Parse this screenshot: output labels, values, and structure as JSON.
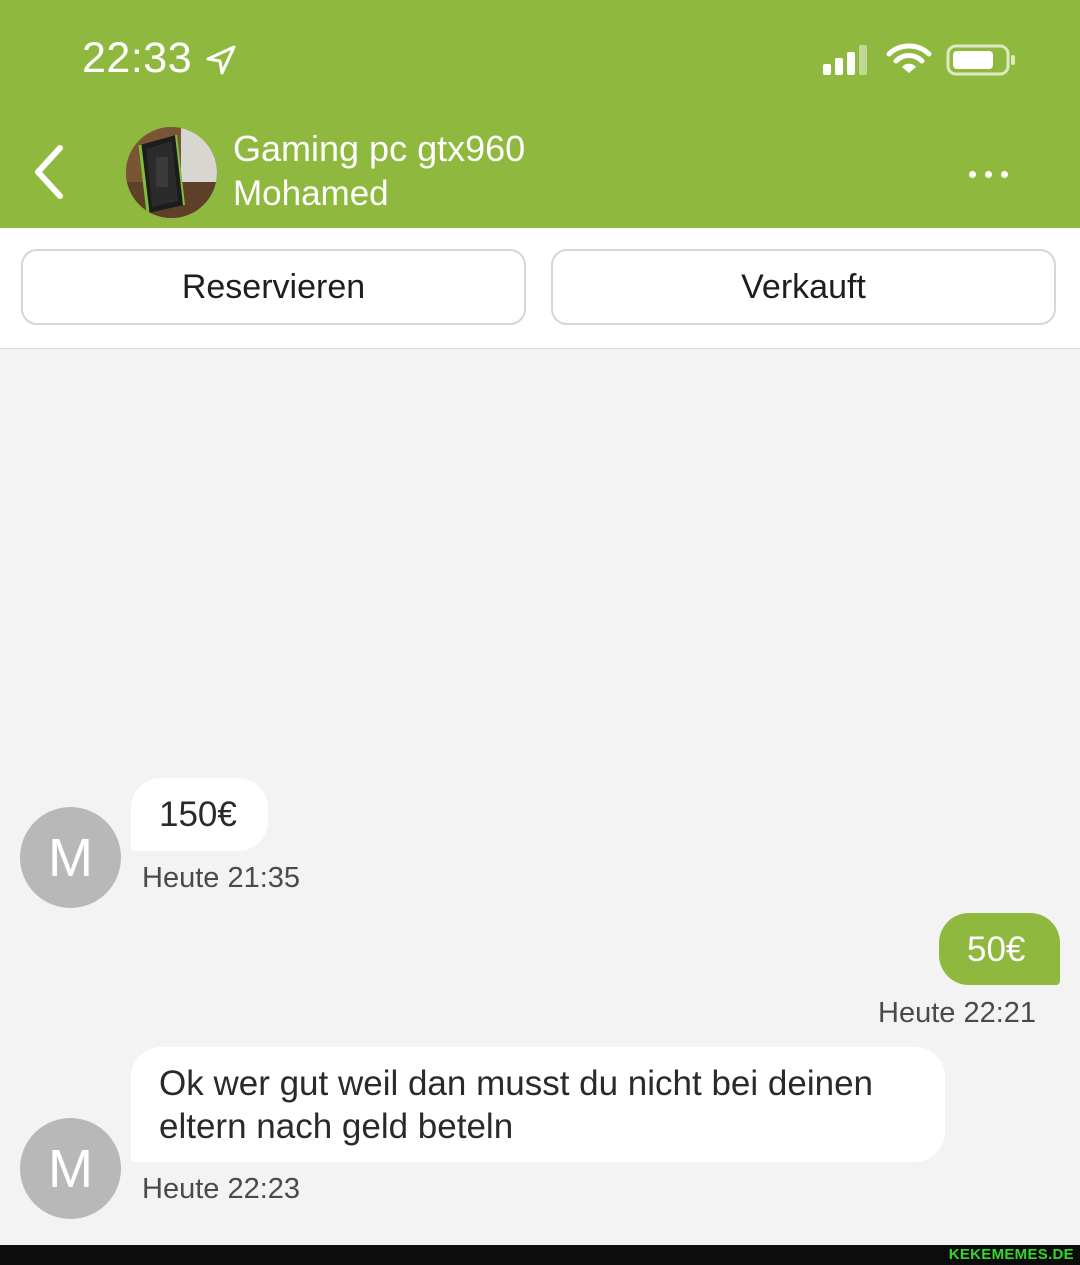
{
  "status_bar": {
    "time": "22:33",
    "icons": [
      "location-arrow-icon",
      "signal-bars-icon",
      "wifi-icon",
      "battery-icon"
    ]
  },
  "header": {
    "title": "Gaming pc gtx960",
    "subtitle": "Mohamed",
    "back_icon": "chevron-left-icon",
    "more_icon": "ellipsis-icon",
    "background_color": "#8fb83e"
  },
  "actions": {
    "reserve_label": "Reservieren",
    "sold_label": "Verkauft"
  },
  "messages": [
    {
      "sender": "M",
      "direction": "incoming",
      "text": "150€",
      "time": "Heute 21:35"
    },
    {
      "direction": "outgoing",
      "text": "50€",
      "time": "Heute 22:21"
    },
    {
      "sender": "M",
      "direction": "incoming",
      "text_lines": [
        "Ok wer gut weil dan musst du nicht bei deinen",
        "eltern nach geld beteln"
      ],
      "time": "Heute 22:23"
    }
  ],
  "watermark": "KEKEMEMES.DE",
  "colors": {
    "accent": "#8fb83e",
    "chat_background": "#f3f3f3",
    "avatar_placeholder": "#b8b8b8"
  }
}
